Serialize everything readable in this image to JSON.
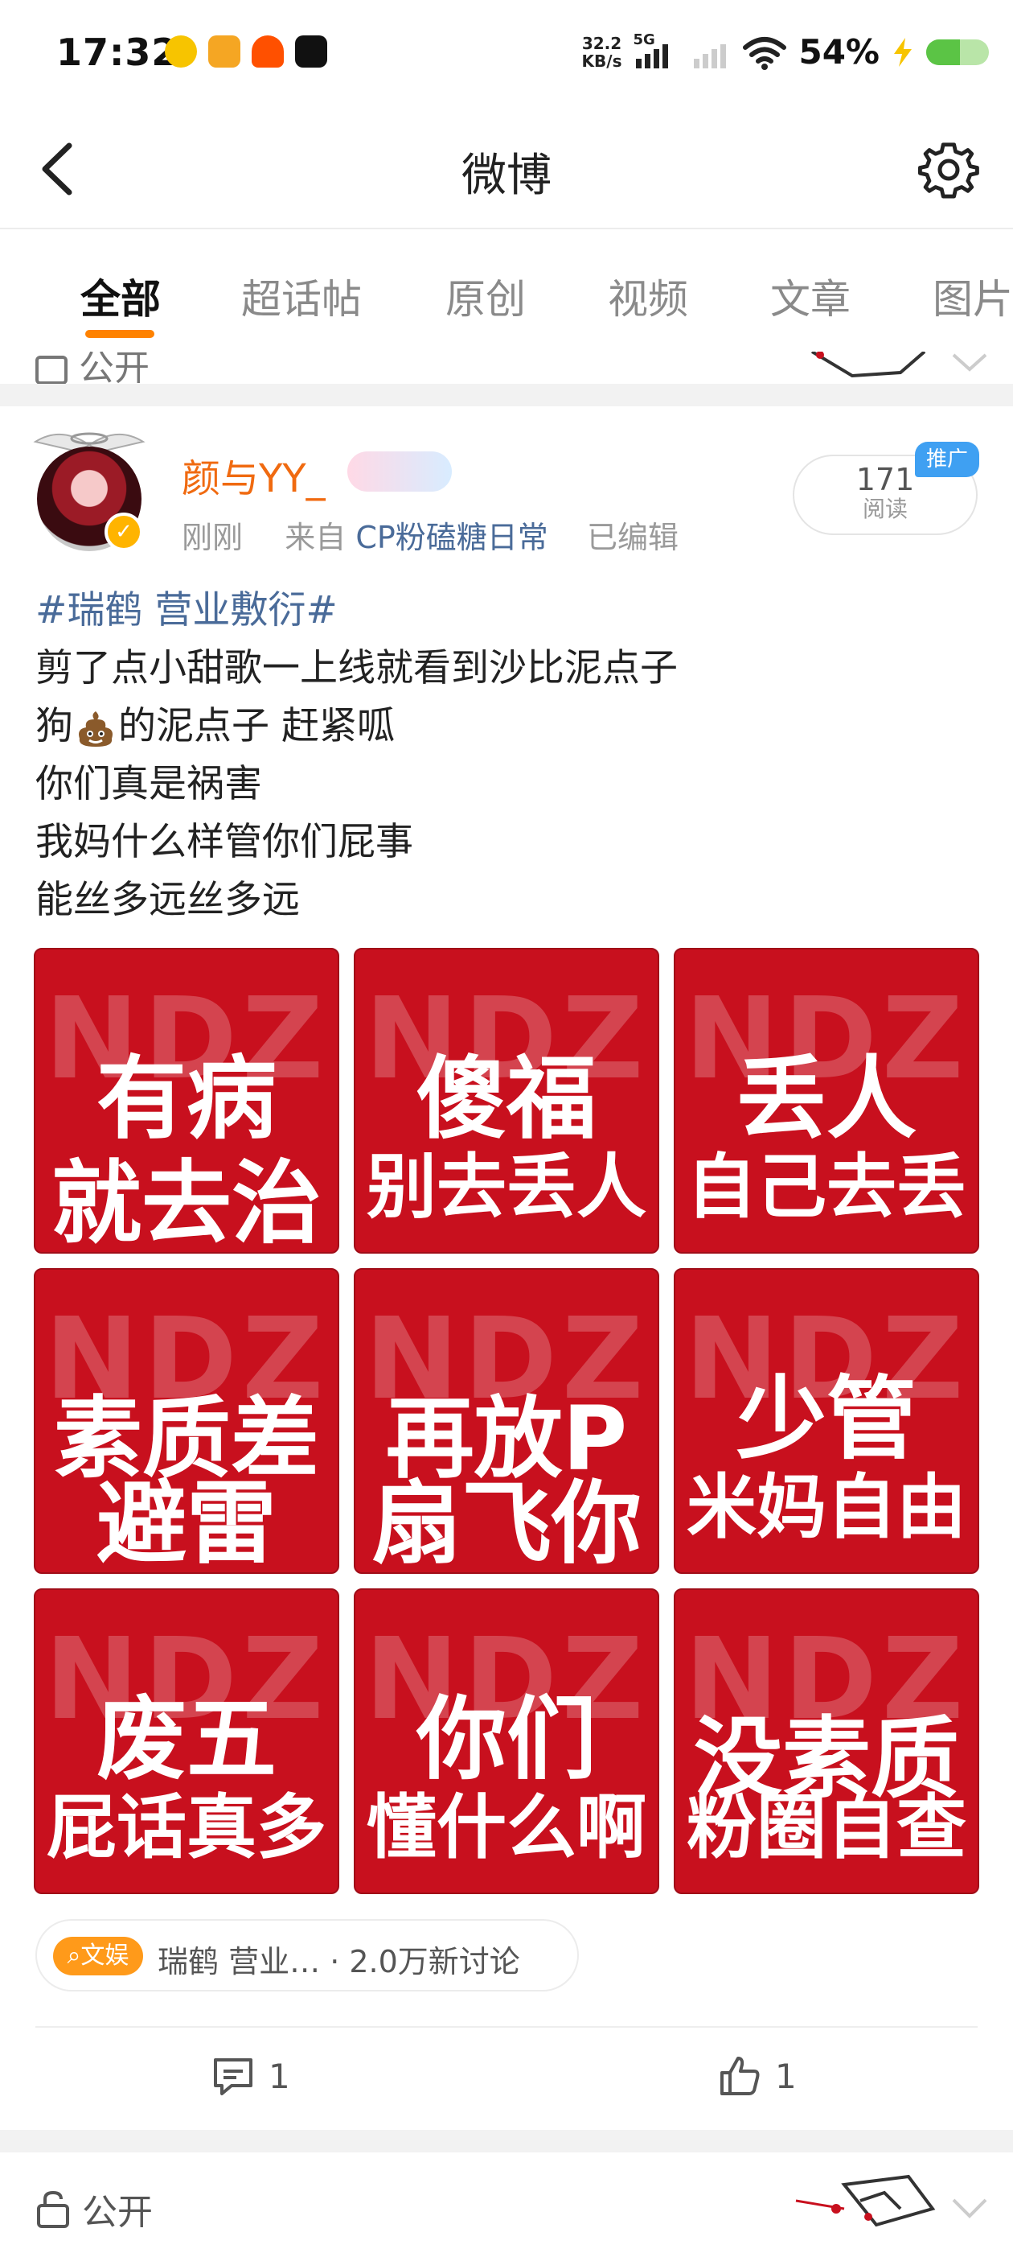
{
  "status": {
    "time": "17:32",
    "speed_value": "32.2",
    "speed_unit": "KB/s",
    "network": "5G",
    "battery": "54%"
  },
  "header": {
    "title": "微博"
  },
  "tabs": [
    {
      "label": "全部",
      "active": true
    },
    {
      "label": "超话帖",
      "active": false
    },
    {
      "label": "原创",
      "active": false
    },
    {
      "label": "视频",
      "active": false
    },
    {
      "label": "文章",
      "active": false
    },
    {
      "label": "图片",
      "active": false
    }
  ],
  "prev_post": {
    "visibility": "公开"
  },
  "post": {
    "username": "颜与YY_",
    "time": "刚刚",
    "source_prefix": "来自",
    "source": "CP粉磕糖日常",
    "edited": "已编辑",
    "reads_count": "171",
    "reads_label": "阅读",
    "promo": "推广",
    "topic": "#瑞鹤 营业敷衍#",
    "lines": [
      "剪了点小甜歌一上线就看到沙比泥点子",
      "狗",
      "的泥点子 赶紧呱",
      "你们真是祸害",
      "我妈什么样管你们屁事",
      "能丝多远丝多远"
    ],
    "images": [
      {
        "watermark": "NDZ",
        "line1": "有病",
        "line2": "就去治"
      },
      {
        "watermark": "NDZ",
        "line1": "傻福",
        "line2": "别去丢人"
      },
      {
        "watermark": "NDZ",
        "line1": "丢人",
        "line2": "自己去丢"
      },
      {
        "watermark": "NDZ",
        "line1": "素质差",
        "line2": "避雷"
      },
      {
        "watermark": "NDZ",
        "line1": "再放P",
        "line2": "扇飞你"
      },
      {
        "watermark": "NDZ",
        "line1": "少管",
        "line2": "米妈自由"
      },
      {
        "watermark": "NDZ",
        "line1": "废五",
        "line2": "屁话真多"
      },
      {
        "watermark": "NDZ",
        "line1": "你们",
        "line2": "懂什么啊"
      },
      {
        "watermark": "NDZ",
        "line1": "没素质",
        "line2": "粉圈自查"
      }
    ],
    "topic_chip": {
      "tag": "文娱",
      "text": "瑞鹤 营业…",
      "count": "· 2.0万新讨论"
    },
    "comments": "1",
    "likes": "1"
  },
  "next_post": {
    "visibility": "公开"
  },
  "colors": {
    "accent": "#ff8200",
    "username": "#f06a10",
    "link": "#4a6b99",
    "image_red": "#c8101e"
  }
}
